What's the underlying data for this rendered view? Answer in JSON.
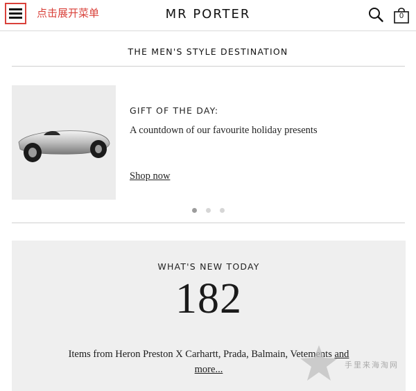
{
  "header": {
    "menu_icon": "hamburger-menu-icon",
    "annotation": "点击展开菜单",
    "annotation_color": "#d9413a",
    "logo": "MR PORTER",
    "search_icon": "search-icon",
    "bag_icon": "shopping-bag-icon",
    "bag_count": "0"
  },
  "tagline": "THE MEN'S STYLE DESTINATION",
  "promo": {
    "image_alt": "silver toy race car",
    "title": "GIFT OF THE DAY:",
    "description": "A countdown of our favourite holiday presents",
    "link": "Shop now",
    "carousel_pages": 3,
    "carousel_active": 1
  },
  "whats_new": {
    "title": "WHAT'S NEW TODAY",
    "count": "182",
    "items_text": "Items from Heron Preston X Carhartt, Prada, Balmain, Vetements",
    "more_link": "and more..."
  },
  "watermark": {
    "icon": "star-icon",
    "text": "手里来海淘网"
  }
}
